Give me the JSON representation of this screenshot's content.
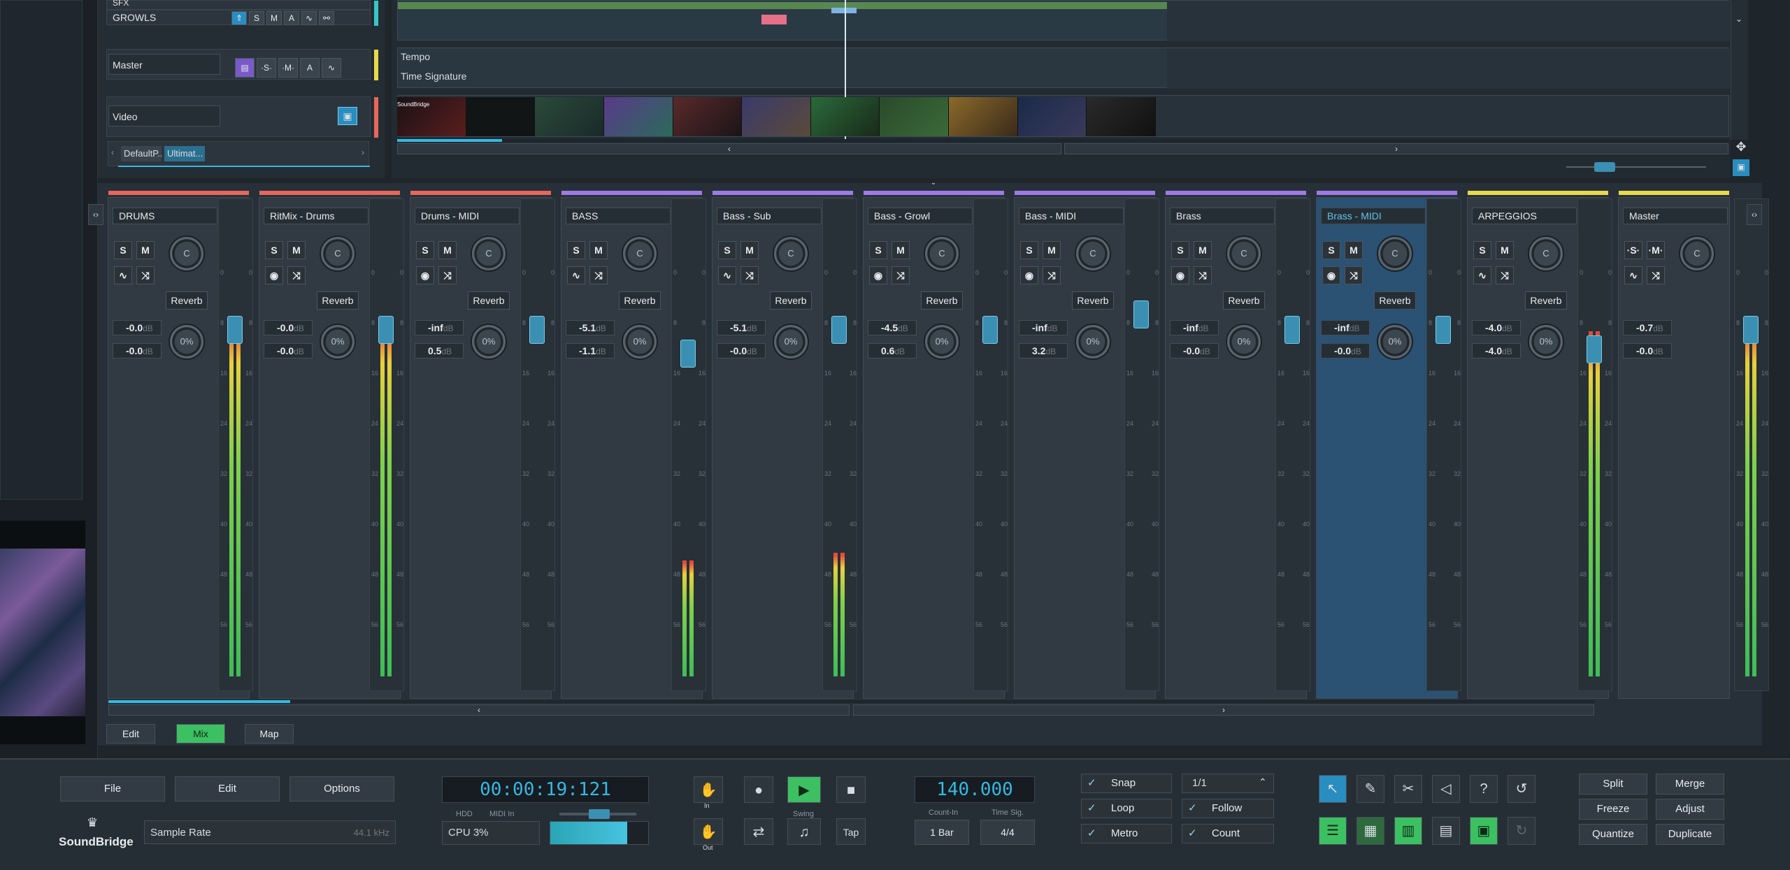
{
  "tracks": [
    {
      "name": "SFX"
    },
    {
      "name": "GROWLS"
    },
    {
      "name": "Master"
    },
    {
      "name": "Video"
    }
  ],
  "track_buttons": {
    "s": "S",
    "m": "M",
    "a": "A"
  },
  "lanes": {
    "tempo": "Tempo",
    "time_signature": "Time Signature",
    "video_logo": "SoundBridge"
  },
  "tabs": [
    "DefaultP...",
    "Ultimat..."
  ],
  "channels": [
    {
      "name": "DRUMS",
      "color": "#e8675a",
      "pan": "C",
      "send": "Reverb",
      "vol": "-0.0",
      "vol2": "-0.0",
      "send_pct": "0%",
      "meter": 0.98,
      "fader": 0.12,
      "dB": "dB"
    },
    {
      "name": "RitMix - Drums",
      "color": "#e8675a",
      "pan": "C",
      "send": "Reverb",
      "vol": "-0.0",
      "vol2": "-0.0",
      "send_pct": "0%",
      "meter": 0.98,
      "fader": 0.12,
      "dB": "dB"
    },
    {
      "name": "Drums - MIDI",
      "color": "#e8675a",
      "pan": "C",
      "send": "Reverb",
      "vol": "-inf",
      "vol2": "0.5",
      "send_pct": "0%",
      "meter": 0,
      "fader": 0.12,
      "dB": "dB"
    },
    {
      "name": "BASS",
      "color": "#a07ae6",
      "pan": "C",
      "send": "Reverb",
      "vol": "-5.1",
      "vol2": "-1.1",
      "send_pct": "0%",
      "meter": 0.32,
      "fader": 0.18,
      "dB": "dB"
    },
    {
      "name": "Bass - Sub",
      "color": "#a07ae6",
      "pan": "C",
      "send": "Reverb",
      "vol": "-5.1",
      "vol2": "-0.0",
      "send_pct": "0%",
      "meter": 0.34,
      "fader": 0.12,
      "dB": "dB"
    },
    {
      "name": "Bass - Growl",
      "color": "#a07ae6",
      "pan": "C",
      "send": "Reverb",
      "vol": "-4.5",
      "vol2": "0.6",
      "send_pct": "0%",
      "meter": 0,
      "fader": 0.12,
      "dB": "dB"
    },
    {
      "name": "Bass - MIDI",
      "color": "#a07ae6",
      "pan": "C",
      "send": "Reverb",
      "vol": "-inf",
      "vol2": "3.2",
      "send_pct": "0%",
      "meter": 0,
      "fader": 0.08,
      "dB": "dB"
    },
    {
      "name": "Brass",
      "color": "#a07ae6",
      "pan": "C",
      "send": "Reverb",
      "vol": "-inf",
      "vol2": "-0.0",
      "send_pct": "0%",
      "meter": 0,
      "fader": 0.12,
      "dB": "dB"
    },
    {
      "name": "Brass - MIDI",
      "color": "#a07ae6",
      "pan": "C",
      "send": "Reverb",
      "vol": "-inf",
      "vol2": "-0.0",
      "send_pct": "0%",
      "meter": 0,
      "fader": 0.12,
      "dB": "dB"
    },
    {
      "name": "ARPEGGIOS",
      "color": "#e8d94a",
      "pan": "C",
      "send": "Reverb",
      "vol": "-4.0",
      "vol2": "-4.0",
      "send_pct": "0%",
      "meter": 0.95,
      "fader": 0.17,
      "dB": "dB"
    },
    {
      "name": "Master",
      "color": "#e8d94a",
      "pan": "C",
      "send": "",
      "vol": "-0.7",
      "vol2": "-0.0",
      "send_pct": "",
      "meter": 0.98,
      "fader": 0.12,
      "dB": "dB"
    }
  ],
  "scale_ticks": [
    "0",
    "8",
    "16",
    "24",
    "32",
    "40",
    "48",
    "56"
  ],
  "view_buttons": {
    "edit": "Edit",
    "mix": "Mix",
    "map": "Map"
  },
  "transport": {
    "file": "File",
    "edit": "Edit",
    "options": "Options",
    "logo": "SoundBridge",
    "sample_rate_label": "Sample Rate",
    "sample_rate_value": "44.1 kHz",
    "time": "00:00:19:121",
    "hdd": "HDD",
    "midi_in": "MIDI In",
    "swing": "Swing",
    "cpu": "CPU 3%",
    "in": "In",
    "out": "Out",
    "tap": "Tap",
    "tempo": "140.000",
    "count_in_label": "Count-In",
    "count_in_value": "1 Bar",
    "time_sig_label": "Time Sig.",
    "time_sig_value": "4/4",
    "snap": "Snap",
    "snap_value": "1/1",
    "loop": "Loop",
    "follow": "Follow",
    "metro": "Metro",
    "count": "Count",
    "split": "Split",
    "merge": "Merge",
    "freeze": "Freeze",
    "adjust": "Adjust",
    "quantize": "Quantize",
    "duplicate": "Duplicate"
  }
}
